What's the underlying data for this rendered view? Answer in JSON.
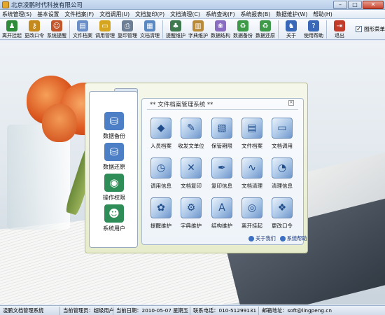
{
  "window": {
    "title": "北京凌鹏时代科技有限公司",
    "controls": [
      "minimize",
      "maximize",
      "close"
    ]
  },
  "menu": {
    "items": [
      "系统管理(S)",
      "基本设置",
      "文件档案(F)",
      "文档调用(U)",
      "文档复印(P)",
      "文档清理(C)",
      "系统查询(F)",
      "系统报表(B)",
      "数据维护(W)",
      "帮助(H)"
    ]
  },
  "toolbar": {
    "buttons": [
      {
        "label": "离开挂起",
        "icon": "user-leave-icon",
        "color": "#2e8b3a"
      },
      {
        "label": "更改口令",
        "icon": "key-icon",
        "color": "#c58a1e"
      },
      {
        "label": "系统提醒",
        "icon": "users-icon",
        "color": "#c2552a"
      },
      {
        "label": "文件档案",
        "icon": "documents-icon",
        "color": "#6a8fc8"
      },
      {
        "label": "调用管理",
        "icon": "folder-icon",
        "color": "#d6a520"
      },
      {
        "label": "复印管理",
        "icon": "printer-icon",
        "color": "#6d7f95"
      },
      {
        "label": "文档清理",
        "icon": "clean-icon",
        "color": "#5a88c2"
      },
      {
        "label": "提醒维护",
        "icon": "reminder-icon",
        "color": "#3f7a4f"
      },
      {
        "label": "字典维护",
        "icon": "dictionary-icon",
        "color": "#b88a3a"
      },
      {
        "label": "数据结构",
        "icon": "structure-icon",
        "color": "#8a6cc0"
      },
      {
        "label": "数据备份",
        "icon": "backup-icon",
        "color": "#3c9a48"
      },
      {
        "label": "数据还原",
        "icon": "restore-icon",
        "color": "#3c9a48"
      },
      {
        "label": "关于",
        "icon": "about-icon",
        "color": "#3a68b8"
      },
      {
        "label": "使用帮助",
        "icon": "help-icon",
        "color": "#3a68b8"
      },
      {
        "label": "退出",
        "icon": "exit-icon",
        "color": "#c23a2a"
      }
    ],
    "checkbox": {
      "label": "图形菜单",
      "checked": true
    }
  },
  "left_panel": {
    "items": [
      {
        "label": "数据备份",
        "icon": "backup-icon",
        "color": "#4d7fc6"
      },
      {
        "label": "数据还原",
        "icon": "restore-icon",
        "color": "#4d7fc6"
      },
      {
        "label": "操作权限",
        "icon": "permission-icon",
        "color": "#2f8e58"
      },
      {
        "label": "系统用户",
        "icon": "system-user-icon",
        "color": "#2f8e58"
      }
    ]
  },
  "panel": {
    "title": "** 文件档案管理系统 **",
    "grid": [
      {
        "label": "人员档案",
        "icon": "personnel-icon"
      },
      {
        "label": "收发文单位",
        "icon": "dispatch-unit-icon"
      },
      {
        "label": "保管期限",
        "icon": "retention-icon"
      },
      {
        "label": "文件档案",
        "icon": "file-archive-icon"
      },
      {
        "label": "文档调用",
        "icon": "doc-borrow-icon"
      },
      {
        "label": "调用信息",
        "icon": "borrow-info-icon"
      },
      {
        "label": "文档复印",
        "icon": "doc-copy-icon"
      },
      {
        "label": "复印信息",
        "icon": "copy-info-icon"
      },
      {
        "label": "文档清理",
        "icon": "doc-clean-icon"
      },
      {
        "label": "清理信息",
        "icon": "clean-info-icon"
      },
      {
        "label": "提醒维护",
        "icon": "reminder-maint-icon"
      },
      {
        "label": "字典维护",
        "icon": "dictionary-maint-icon"
      },
      {
        "label": "结构维护",
        "icon": "structure-maint-icon"
      },
      {
        "label": "离开挂起",
        "icon": "suspend-icon"
      },
      {
        "label": "更改口令",
        "icon": "change-password-icon"
      }
    ],
    "footer": {
      "about": "关于我们",
      "help": "系统帮助"
    }
  },
  "status": {
    "system": "凌鹏文档管理系统",
    "user": "当前管理员：超级用户",
    "date": "当前日期：2010-05-07 星期五",
    "phone": "联系电话：010-51299131",
    "email": "邮箱地址：soft@lingpeng.cn"
  }
}
